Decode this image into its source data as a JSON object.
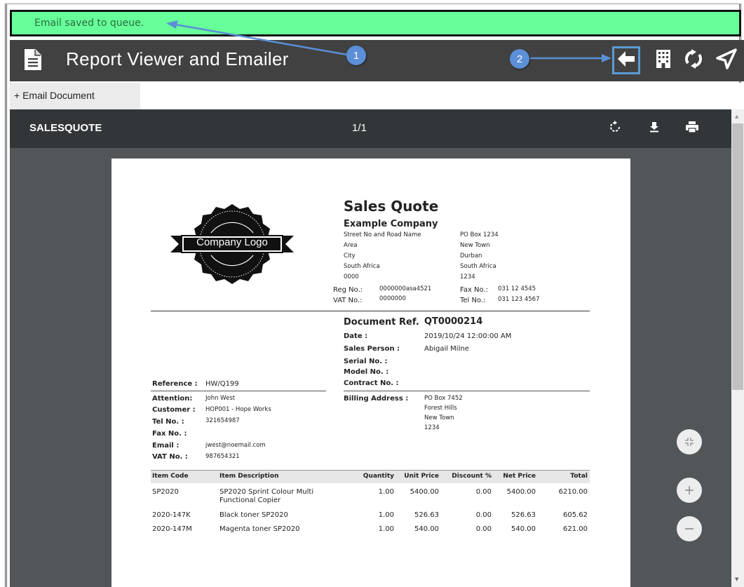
{
  "notification": {
    "text": "Email saved to queue."
  },
  "app": {
    "title": "Report Viewer and Emailer"
  },
  "toolbar": {
    "icons": [
      "document-icon",
      "back-arrow-icon",
      "building-icon",
      "refresh-icon",
      "send-icon"
    ],
    "highlight_color": "#5b9bd5",
    "bar_color": "#414141"
  },
  "tabs": [
    {
      "label": "+ Email Document"
    }
  ],
  "viewer": {
    "document_name": "SALESQUOTE",
    "page_indicator": "1/1"
  },
  "callouts": [
    "1",
    "2"
  ],
  "document": {
    "logo_text": "Company Logo",
    "title": "Sales Quote",
    "company": "Example Company",
    "address_left": [
      "Street No and Road Name",
      "Area",
      "City",
      "South Africa",
      "0000"
    ],
    "address_right": [
      "PO Box 1234",
      "New Town",
      "Durban",
      "South Africa",
      "1234"
    ],
    "reg_label": "Reg No.:",
    "reg_value": "0000000asa4521",
    "vat_label": "VAT No.:",
    "vat_value": "0000000",
    "fax_label": "Fax No.:",
    "fax_value": "031 12 4545",
    "tel_label": "Tel No.:",
    "tel_value": "031 123 4567",
    "docref_label": "Document Ref.",
    "docref_value": "QT0000214",
    "date_label": "Date :",
    "date_value": "2019/10/24 12:00:00 AM",
    "salesperson_label": "Sales Person :",
    "salesperson_value": "Abigail Milne",
    "serial_label": "Serial No. :",
    "model_label": "Model No. :",
    "contract_label": "Contract No. :",
    "reference_label": "Reference :",
    "reference_value": "HW/Q199",
    "attention_label": "Attention:",
    "attention_value": "John West",
    "customer_label": "Customer :",
    "customer_value": "HOP001 - Hope Works",
    "ctel_label": "Tel No. :",
    "ctel_value": "321654987",
    "cfax_label": "Fax No. :",
    "email_label": "Email :",
    "email_value": "jwest@noemail.com",
    "cvat_label": "VAT No. :",
    "cvat_value": "987654321",
    "billing_label": "Billing Address :",
    "billing_lines": [
      "PO Box 7452",
      "Forest Hills",
      "New Town",
      "1234"
    ],
    "columns": [
      "Item Code",
      "Item Description",
      "Quantity",
      "Unit Price",
      "Discount %",
      "Net Price",
      "Total"
    ],
    "rows": [
      {
        "code": "SP2020",
        "desc1": "SP2020 Sprint Colour Multi",
        "desc2": "Functional Copier",
        "qty": "1.00",
        "unit": "5400.00",
        "disc": "0.00",
        "net": "5400.00",
        "total": "6210.00"
      },
      {
        "code": "2020-147K",
        "desc1": "Black toner SP2020",
        "desc2": "",
        "qty": "1.00",
        "unit": "526.63",
        "disc": "0.00",
        "net": "526.63",
        "total": "605.62"
      },
      {
        "code": "2020-147M",
        "desc1": "Magenta toner SP2020",
        "desc2": "",
        "qty": "1.00",
        "unit": "540.00",
        "disc": "0.00",
        "net": "540.00",
        "total": "621.00"
      }
    ]
  }
}
